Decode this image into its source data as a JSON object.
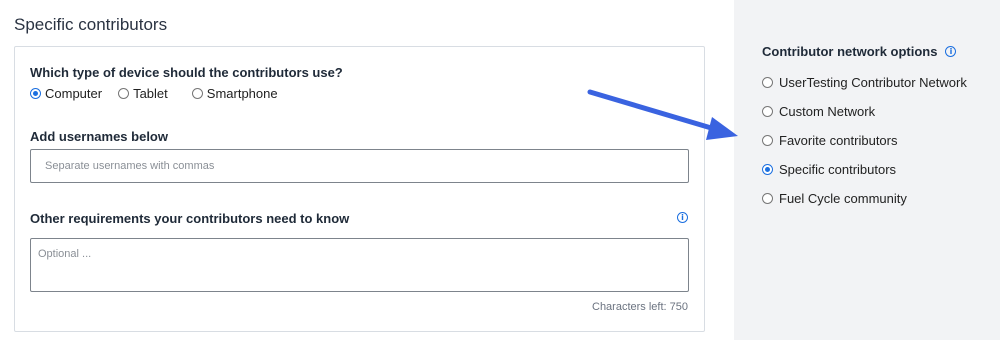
{
  "section_title": "Specific contributors",
  "device": {
    "question": "Which type of device should the contributors use?",
    "options": [
      {
        "label": "Computer",
        "checked": true
      },
      {
        "label": "Tablet",
        "checked": false
      },
      {
        "label": "Smartphone",
        "checked": false
      }
    ]
  },
  "usernames": {
    "label": "Add usernames below",
    "placeholder": "Separate usernames with commas",
    "value": ""
  },
  "requirements": {
    "label": "Other requirements your contributors need to know",
    "placeholder": "Optional ...",
    "value": "",
    "chars_left": "Characters left: 750",
    "info_icon": "info-icon"
  },
  "sidebar": {
    "title": "Contributor network options",
    "info_icon": "info-icon",
    "options": [
      {
        "label": "UserTesting Contributor Network",
        "checked": false
      },
      {
        "label": "Custom Network",
        "checked": false
      },
      {
        "label": "Favorite contributors",
        "checked": false
      },
      {
        "label": "Specific contributors",
        "checked": true
      },
      {
        "label": "Fuel Cycle community",
        "checked": false
      }
    ]
  },
  "colors": {
    "accent": "#1b6fe0",
    "arrow": "#3a63e0",
    "sidebar_bg": "#f2f3f5"
  }
}
